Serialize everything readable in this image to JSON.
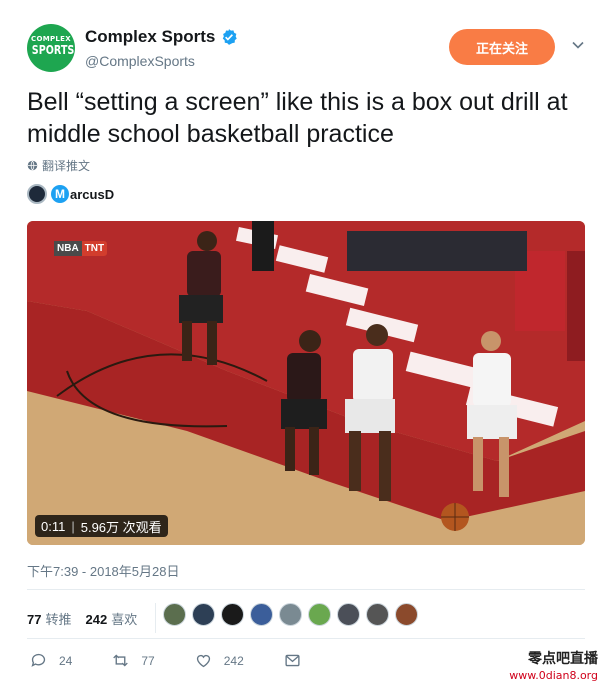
{
  "author": {
    "avatar_logo_top": "COMPLEX",
    "avatar_logo_bottom": "SPORTS",
    "display_name": "Complex Sports",
    "handle": "@ComplexSports",
    "verified": true,
    "avatar_color": "#1ea650"
  },
  "follow_button": {
    "label": "正在关注",
    "color": "#f97c45"
  },
  "tweet": {
    "text": "Bell “setting a screen” like this is a box out drill at middle school basketball practice",
    "translate_label": "翻译推文",
    "credit_name": "arcusD",
    "credit_initial": "M"
  },
  "video": {
    "broadcast_left": "NBA",
    "broadcast_right": "TNT",
    "duration": "0:11",
    "views": "5.96万 次观看"
  },
  "timestamp": "下午7:39 - 2018年5月28日",
  "stats": {
    "retweets_count": "77",
    "retweets_label": "转推",
    "likes_count": "242",
    "likes_label": "喜欢"
  },
  "likers": [
    "#5b6e4e",
    "#2d3f55",
    "#1a1a1a",
    "#3b5e9a",
    "#7a8a92",
    "#6aa84f",
    "#4b4f58",
    "#555555",
    "#8b4a2c"
  ],
  "actions": {
    "reply_count": "24",
    "retweet_count": "77",
    "like_count": "242"
  },
  "watermark": {
    "title": "零点吧直播",
    "url": "www.0dian8.org"
  }
}
